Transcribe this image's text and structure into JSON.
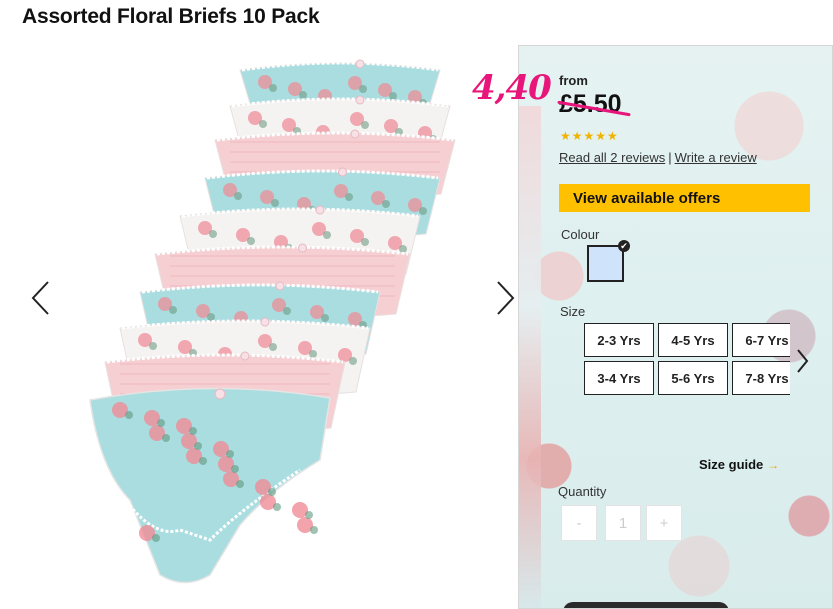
{
  "product": {
    "title": "Assorted Floral Briefs 10 Pack"
  },
  "gallery": {
    "image_alt": "Pink, white and blue floral briefs fanned out",
    "prev_icon": "chevron-left-icon",
    "next_icon": "chevron-right-icon"
  },
  "pricing": {
    "from_label": "from",
    "old_price": "£5.50",
    "new_price_handwritten": "4,40",
    "highlight_color": "#e8157a"
  },
  "rating": {
    "stars": "★★★★★",
    "star_color": "#f0b400",
    "read_reviews_label": "Read all 2 reviews",
    "separator": "|",
    "write_review_label": "Write a review"
  },
  "offers": {
    "button_label": "View available offers",
    "button_color": "#ffc000"
  },
  "colour": {
    "label": "Colour",
    "selected_swatch_color": "#cfe4fb",
    "check_icon": "✔"
  },
  "size": {
    "label": "Size",
    "options": [
      "2-3 Yrs",
      "4-5 Yrs",
      "6-7 Yrs",
      "3-4 Yrs",
      "5-6 Yrs",
      "7-8 Yrs"
    ],
    "next_icon": "chevron-right-icon",
    "guide_label": "Size guide",
    "guide_arrow": "→"
  },
  "quantity": {
    "label": "Quantity",
    "minus": "-",
    "value": "1",
    "plus": "+"
  }
}
